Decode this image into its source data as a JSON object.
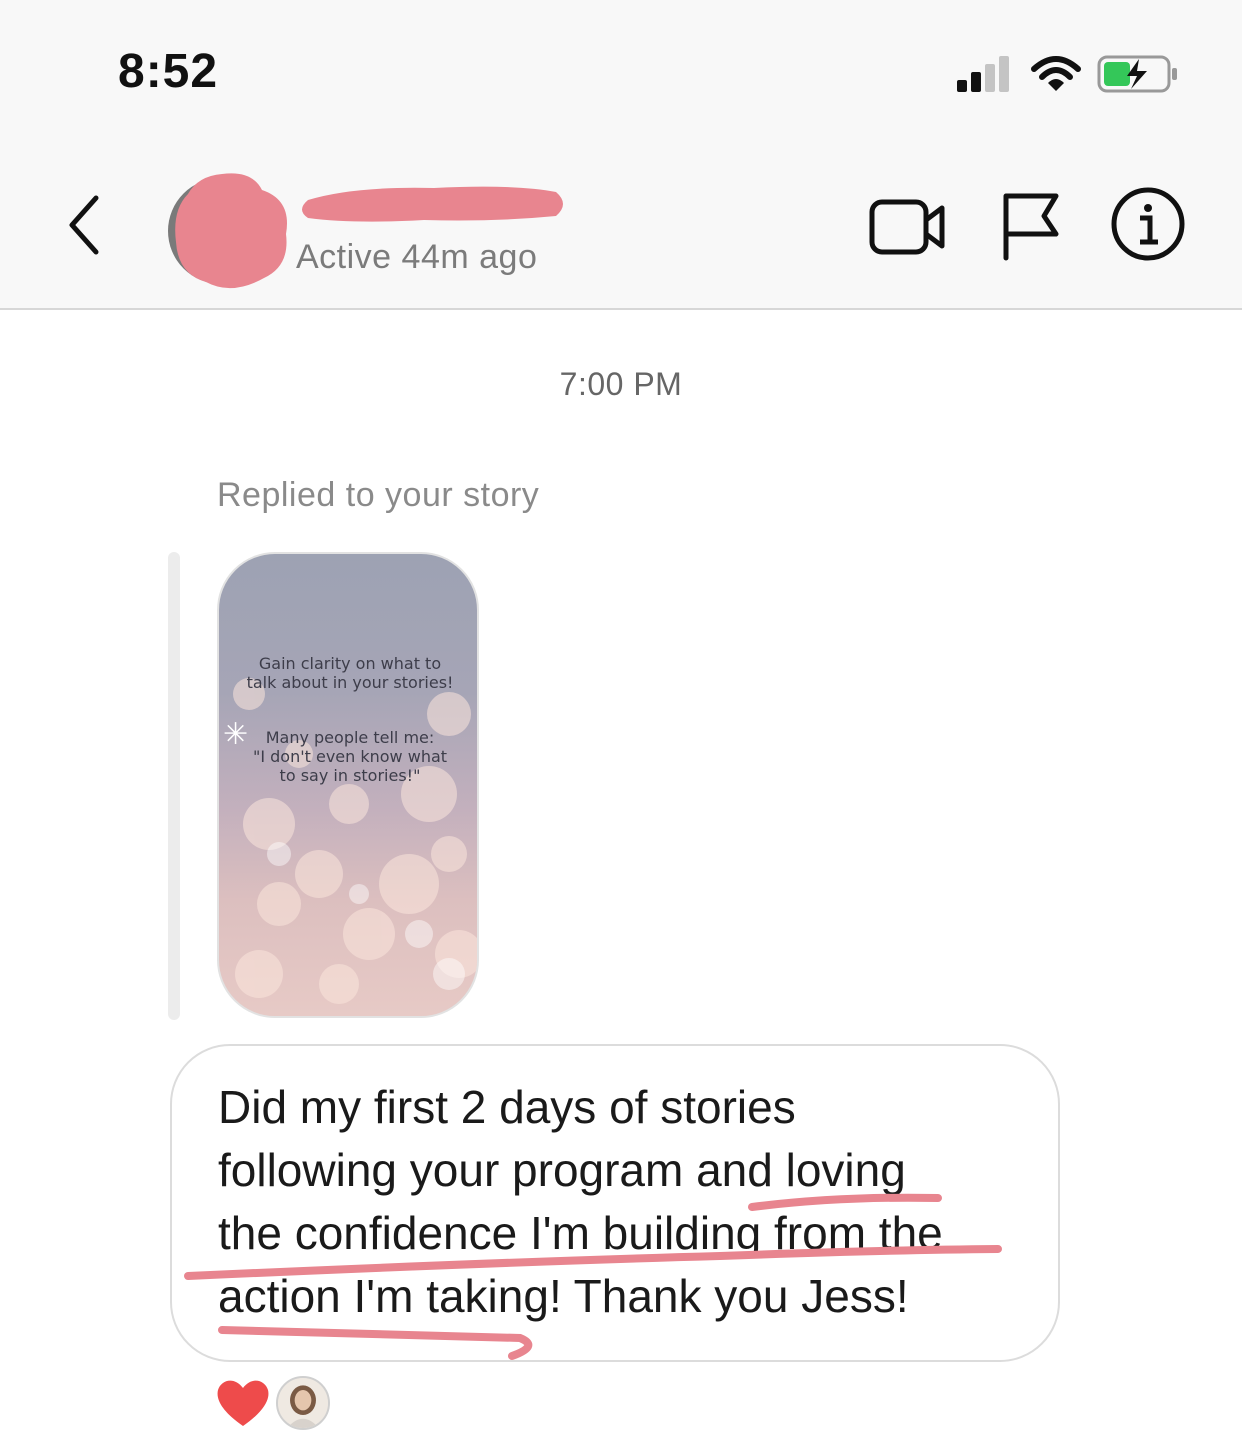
{
  "status_bar": {
    "time": "8:52",
    "signal_icon": "cellular-signal-icon",
    "wifi_icon": "wifi-icon",
    "battery_icon": "battery-charging-icon",
    "battery_color": "#34c759"
  },
  "header": {
    "back_icon": "chevron-left-icon",
    "active_status": "Active 44m ago",
    "actions": [
      "video-call-icon",
      "flag-icon",
      "info-icon"
    ],
    "redaction_color": "#e8858f"
  },
  "thread": {
    "timestamp": "7:00 PM",
    "reply_label": "Replied to your story",
    "story": {
      "line1": "Gain clarity on what to",
      "line2": "talk about in your stories!",
      "line3": "Many people tell me:",
      "line4": "\"I don't even know what",
      "line5": "to say in stories!\""
    },
    "message": {
      "line1": "Did my first 2 days of stories",
      "line2": "following your program and loving",
      "line3": "the confidence I'm building from the",
      "line4": "action I'm taking! Thank you Jess!"
    },
    "reactions": {
      "heart_icon": "heart-icon",
      "heart_color": "#ee4b4b"
    }
  }
}
